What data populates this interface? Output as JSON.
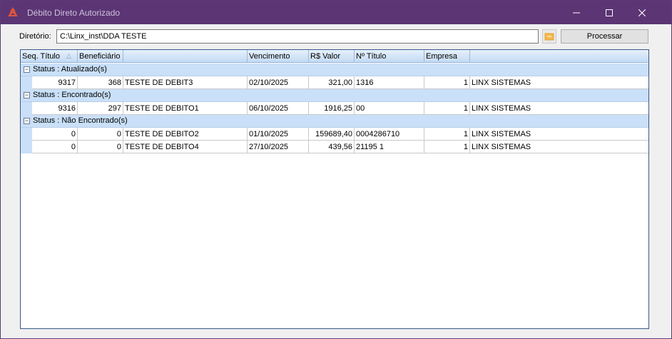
{
  "window": {
    "title": "Débito Direto Autorizado",
    "minimize_symbol": "—",
    "maximize_symbol": "☐",
    "close_symbol": "✕"
  },
  "form": {
    "directory_label": "Diretório:",
    "directory_value": "C:\\Linx_inst\\DDA TESTE",
    "folder_icon": "folder-icon",
    "process_label": "Processar"
  },
  "grid": {
    "columns": [
      "Seq. Título",
      "Beneficiário",
      "",
      "Vencimento",
      "R$ Valor",
      "Nº Título",
      "Empresa",
      ""
    ],
    "sort_indicator": "△",
    "groups": [
      {
        "label": "Status : Atualizado(s)",
        "toggle": "−",
        "rows": [
          [
            "9317",
            "368",
            "TESTE DE DEBIT3",
            "02/10/2025",
            "321,00",
            "1316",
            "1",
            "LINX SISTEMAS"
          ]
        ]
      },
      {
        "label": "Status : Encontrado(s)",
        "toggle": "−",
        "rows": [
          [
            "9316",
            "297",
            "TESTE DE DEBITO1",
            "06/10/2025",
            "1916,25",
            "00",
            "1",
            "LINX SISTEMAS"
          ]
        ]
      },
      {
        "label": "Status : Não Encontrado(s)",
        "toggle": "−",
        "rows": [
          [
            "0",
            "0",
            "TESTE DE DEBITO2",
            "01/10/2025",
            "159689,40",
            "0004286710",
            "1",
            "LINX SISTEMAS"
          ],
          [
            "0",
            "0",
            "TESTE DE DEBITO4",
            "27/10/2025",
            "439,56",
            "21195 1",
            "1",
            "LINX SISTEMAS"
          ]
        ]
      }
    ]
  },
  "colors": {
    "titlebar": "#5b3574",
    "group_band": "#c9e0f8",
    "grid_border": "#3a5a8a"
  }
}
